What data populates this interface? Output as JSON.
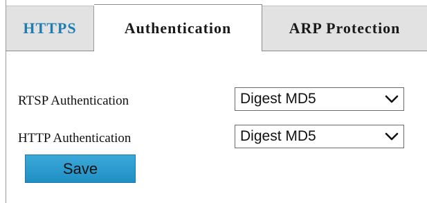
{
  "tabs": [
    {
      "label": "HTTPS",
      "active": false
    },
    {
      "label": "Authentication",
      "active": true
    },
    {
      "label": "ARP Protection",
      "active": false
    }
  ],
  "form": {
    "rtsp": {
      "label": "RTSP Authentication",
      "value": "Digest MD5"
    },
    "http": {
      "label": "HTTP Authentication",
      "value": "Digest MD5"
    }
  },
  "actions": {
    "save_label": "Save"
  },
  "colors": {
    "active_tab_text": "#1a1a1a",
    "link_tab_text": "#1f7db1",
    "inactive_tab_bg": "#e2e2e2",
    "save_button_bg": "#2a9bd0"
  },
  "icons": {
    "dropdown": "chevron-down-icon"
  }
}
